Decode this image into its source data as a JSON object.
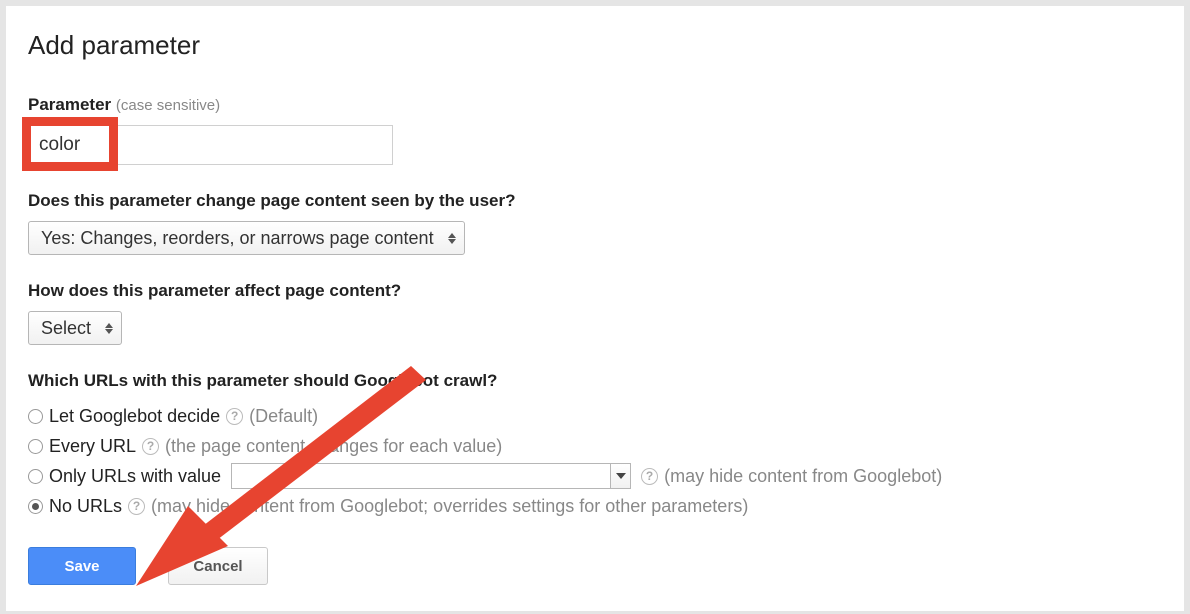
{
  "title": "Add parameter",
  "parameter": {
    "label": "Parameter",
    "hint": "(case sensitive)",
    "value": "color"
  },
  "q_change": {
    "label": "Does this parameter change page content seen by the user?",
    "selected": "Yes: Changes, reorders, or narrows page content"
  },
  "q_affect": {
    "label": "How does this parameter affect page content?",
    "selected": "Select"
  },
  "q_crawl": {
    "label": "Which URLs with this parameter should Googlebot crawl?",
    "options": {
      "decide": {
        "label": "Let Googlebot decide",
        "hint": "(Default)"
      },
      "every": {
        "label": "Every URL",
        "hint": "(the page content changes for each value)"
      },
      "only": {
        "label": "Only URLs with value",
        "hint": "(may hide content from Googlebot)"
      },
      "none": {
        "label": "No URLs",
        "hint": "(may hide content from Googlebot; overrides settings for other parameters)"
      }
    },
    "selected": "none"
  },
  "buttons": {
    "save": "Save",
    "cancel": "Cancel"
  }
}
